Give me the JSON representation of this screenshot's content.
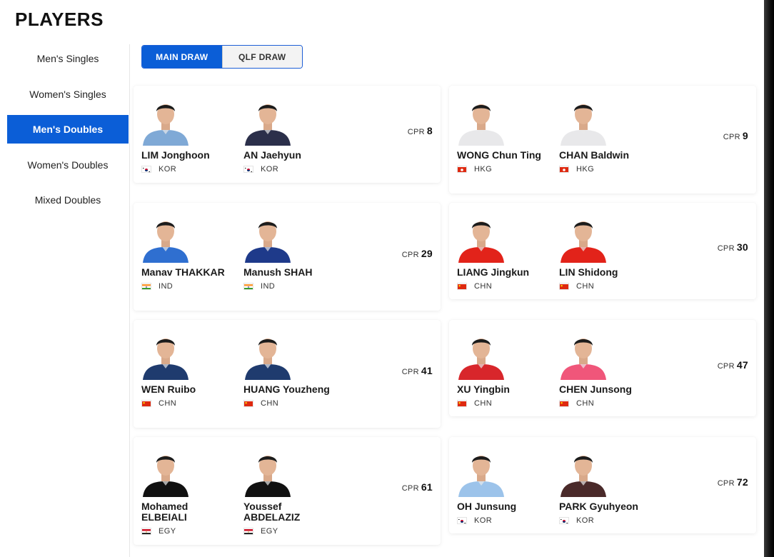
{
  "page_title": "PLAYERS",
  "sidebar": {
    "items": [
      {
        "label": "Men's Singles",
        "active": false
      },
      {
        "label": "Women's Singles",
        "active": false
      },
      {
        "label": "Men's Doubles",
        "active": true
      },
      {
        "label": "Women's Doubles",
        "active": false
      },
      {
        "label": "Mixed Doubles",
        "active": false
      }
    ]
  },
  "draw_toggle": {
    "main_label": "MAIN DRAW",
    "qlf_label": "QLF DRAW",
    "selected": "MAIN DRAW"
  },
  "colors": {
    "accent": "#0b5ed7",
    "text": "#1a1a1a"
  },
  "pairs": [
    {
      "cpr_label": "CPR",
      "cpr_value": "8",
      "players": [
        {
          "name": "LIM Jonghoon",
          "country": "KOR",
          "jersey": "#7fa9d6"
        },
        {
          "name": "AN Jaehyun",
          "country": "KOR",
          "jersey": "#2b2f4a"
        }
      ]
    },
    {
      "cpr_label": "CPR",
      "cpr_value": "9",
      "players": [
        {
          "name": "WONG Chun Ting",
          "country": "HKG",
          "jersey": "#e8e8ea"
        },
        {
          "name": "CHAN Baldwin",
          "country": "HKG",
          "jersey": "#e8e8ea"
        }
      ]
    },
    {
      "cpr_label": "CPR",
      "cpr_value": "29",
      "players": [
        {
          "name": "Manav THAKKAR",
          "country": "IND",
          "jersey": "#2f6fd0"
        },
        {
          "name": "Manush SHAH",
          "country": "IND",
          "jersey": "#1e3a8a"
        }
      ]
    },
    {
      "cpr_label": "CPR",
      "cpr_value": "30",
      "players": [
        {
          "name": "LIANG Jingkun",
          "country": "CHN",
          "jersey": "#e2231a"
        },
        {
          "name": "LIN Shidong",
          "country": "CHN",
          "jersey": "#e2231a"
        }
      ]
    },
    {
      "cpr_label": "CPR",
      "cpr_value": "41",
      "players": [
        {
          "name": "WEN Ruibo",
          "country": "CHN",
          "jersey": "#1f3b6e"
        },
        {
          "name": "HUANG Youzheng",
          "country": "CHN",
          "jersey": "#1f3b6e"
        }
      ]
    },
    {
      "cpr_label": "CPR",
      "cpr_value": "47",
      "players": [
        {
          "name": "XU Yingbin",
          "country": "CHN",
          "jersey": "#d8262b"
        },
        {
          "name": "CHEN Junsong",
          "country": "CHN",
          "jersey": "#f0567a"
        }
      ]
    },
    {
      "cpr_label": "CPR",
      "cpr_value": "61",
      "players": [
        {
          "name": "Mohamed ELBEIALI",
          "country": "EGY",
          "jersey": "#111111"
        },
        {
          "name": "Youssef ABDELAZIZ",
          "country": "EGY",
          "jersey": "#111111"
        }
      ]
    },
    {
      "cpr_label": "CPR",
      "cpr_value": "72",
      "players": [
        {
          "name": "OH Junsung",
          "country": "KOR",
          "jersey": "#9cc3ea"
        },
        {
          "name": "PARK Gyuhyeon",
          "country": "KOR",
          "jersey": "#4a2a2a"
        }
      ]
    }
  ]
}
